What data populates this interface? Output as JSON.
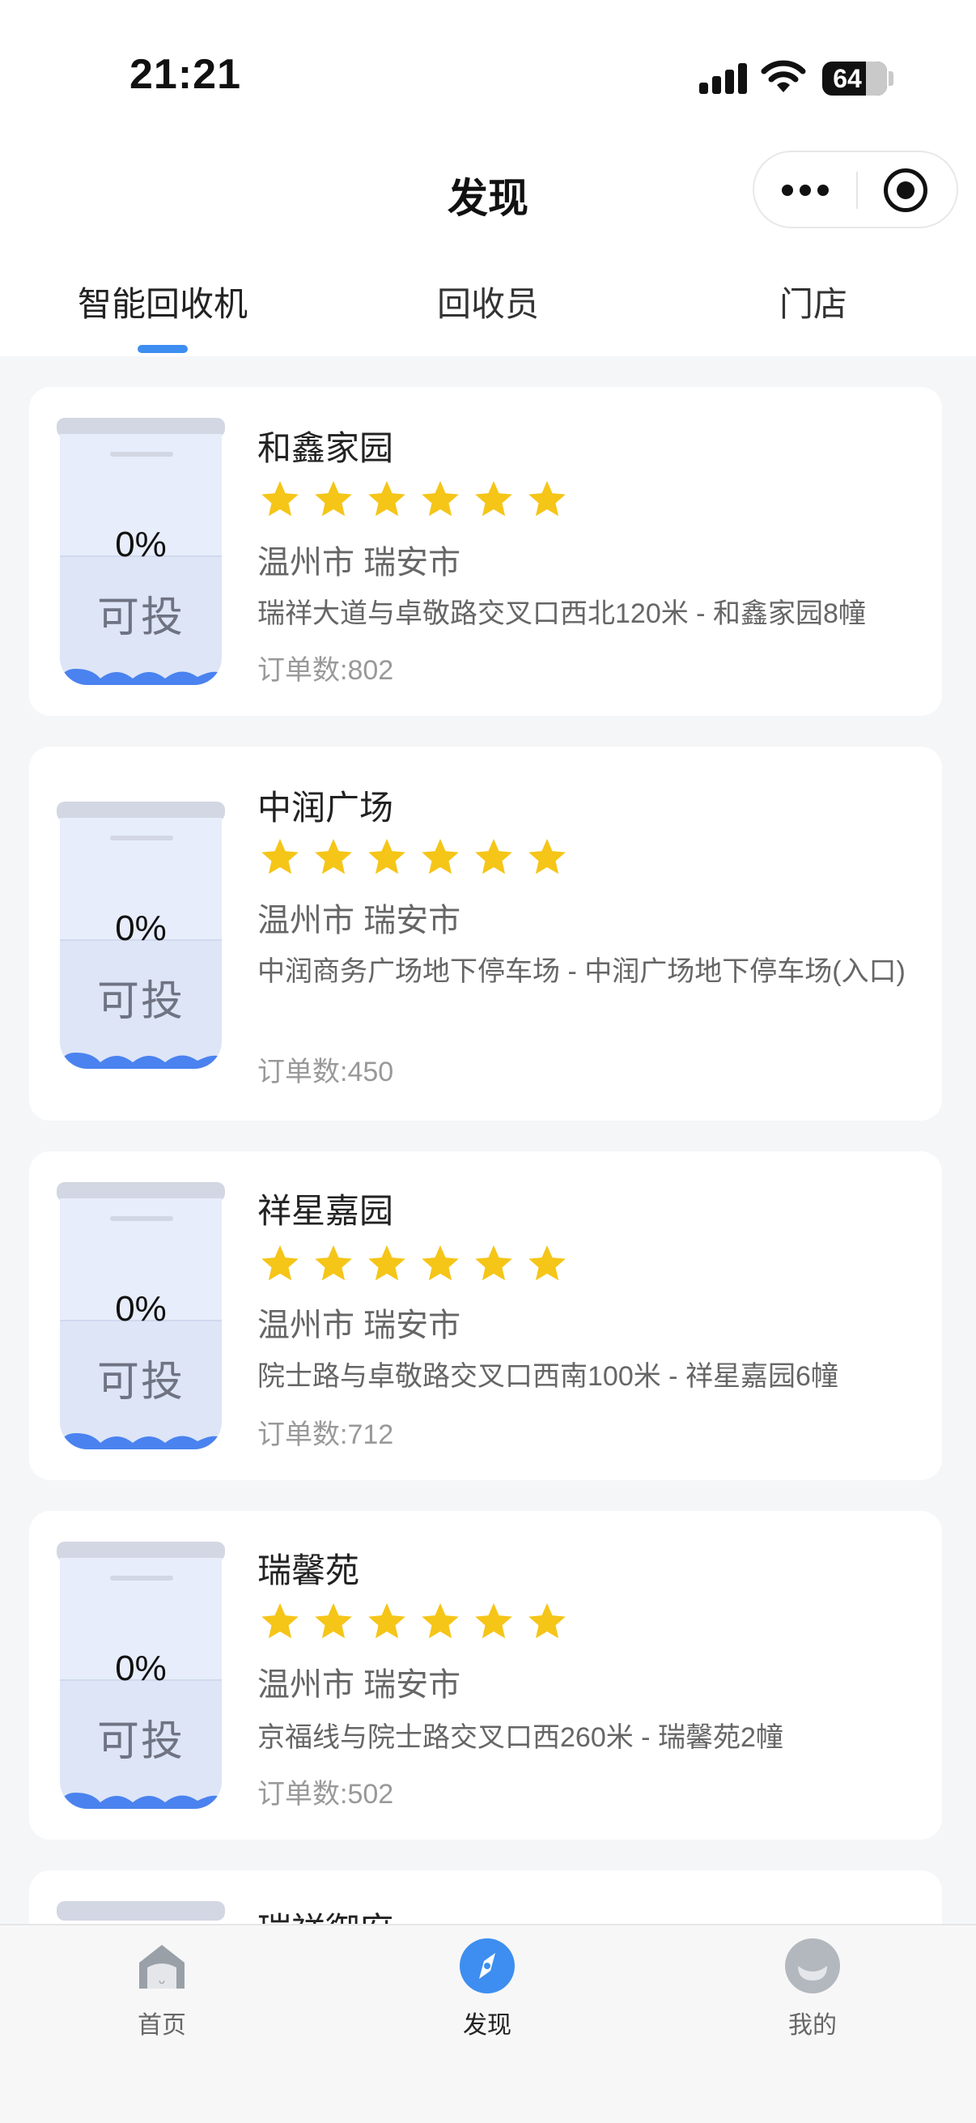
{
  "status_bar": {
    "time": "21:21",
    "battery": "64"
  },
  "header": {
    "title": "发现"
  },
  "tabs": [
    {
      "label": "智能回收机",
      "active": true
    },
    {
      "label": "回收员",
      "active": false
    },
    {
      "label": "门店",
      "active": false
    }
  ],
  "colors": {
    "accent": "#3d8ef0",
    "star": "#f5c518",
    "bin_wave": "#4a82ef"
  },
  "cards": [
    {
      "name": "和鑫家园",
      "rating": 6,
      "fill_percent": "0%",
      "bin_status": "可投",
      "city": "温州市 瑞安市",
      "address": "瑞祥大道与卓敬路交叉口西北120米 - 和鑫家园8幢",
      "orders": "订单数:802"
    },
    {
      "name": "中润广场",
      "rating": 6,
      "fill_percent": "0%",
      "bin_status": "可投",
      "city": "温州市 瑞安市",
      "address": "中润商务广场地下停车场 - 中润广场地下停车场(入口)",
      "orders": "订单数:450"
    },
    {
      "name": "祥星嘉园",
      "rating": 6,
      "fill_percent": "0%",
      "bin_status": "可投",
      "city": "温州市 瑞安市",
      "address": "院士路与卓敬路交叉口西南100米 - 祥星嘉园6幢",
      "orders": "订单数:712"
    },
    {
      "name": "瑞馨苑",
      "rating": 6,
      "fill_percent": "0%",
      "bin_status": "可投",
      "city": "温州市 瑞安市",
      "address": "京福线与院士路交叉口西260米 - 瑞馨苑2幢",
      "orders": "订单数:502"
    },
    {
      "name": "瑞祥御府"
    }
  ],
  "bottom_nav": [
    {
      "label": "首页",
      "icon": "home-icon",
      "active": false
    },
    {
      "label": "发现",
      "icon": "compass-icon",
      "active": true
    },
    {
      "label": "我的",
      "icon": "profile-icon",
      "active": false
    }
  ]
}
